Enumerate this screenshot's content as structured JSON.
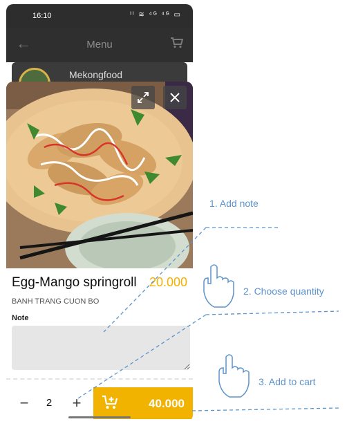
{
  "status_bar": {
    "time": "16:10",
    "icons": "ᴵᴵ ≋ ⁴ᴳ ⁴ᴳ ▭"
  },
  "header": {
    "title": "Menu"
  },
  "shop": {
    "name": "Mekongfood"
  },
  "item": {
    "name": "Egg-Mango springroll",
    "price": "20.000",
    "subtitle": "BANH TRANG CUON BO",
    "note_label": "Note",
    "note_value": ""
  },
  "order": {
    "quantity": "2",
    "minus": "−",
    "plus": "+",
    "total": "40.000"
  },
  "annotations": {
    "step1": "1. Add note",
    "step2": "2. Choose quantity",
    "step3": "3. Add to cart"
  },
  "colors": {
    "accent": "#f2b200",
    "annotation": "#5b93cc",
    "dark_header": "#2f2f2f"
  },
  "icons": [
    "back-arrow-icon",
    "cart-icon",
    "expand-icon",
    "close-icon",
    "cart-plus-icon",
    "hand-pointer-icon"
  ]
}
